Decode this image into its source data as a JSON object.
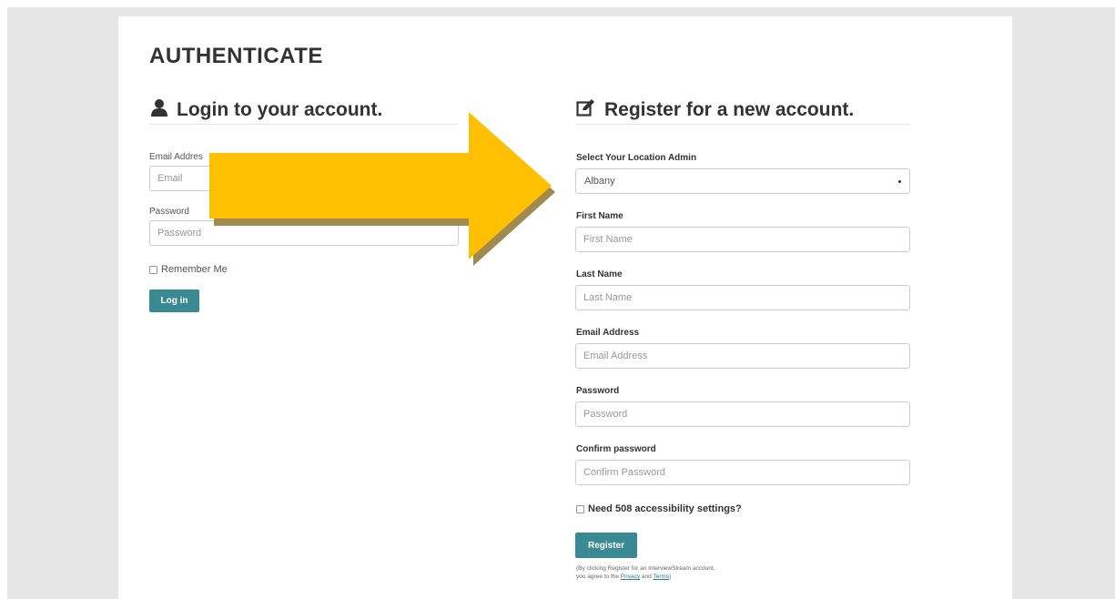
{
  "page": {
    "title": "AUTHENTICATE"
  },
  "login": {
    "heading": "Login to your account.",
    "email_label": "Email Addres",
    "email_placeholder": "Email",
    "password_label": "Password",
    "password_placeholder": "Password",
    "remember_label": "Remember Me",
    "login_button": "Log in"
  },
  "register": {
    "heading": "Register for a new account.",
    "location_label": "Select Your Location Admin",
    "location_value": "Albany",
    "first_name_label": "First Name",
    "first_name_placeholder": "First Name",
    "last_name_label": "Last Name",
    "last_name_placeholder": "Last Name",
    "email_label": "Email Address",
    "email_placeholder": "Email Address",
    "password_label": "Password",
    "password_placeholder": "Password",
    "confirm_label": "Confirm password",
    "confirm_placeholder": "Confirm Password",
    "accessibility_label": "Need 508 accessibility settings?",
    "register_button": "Register",
    "terms_line1": "(By clicking Register for an InterviewStream account,",
    "terms_line2_prefix": "you agree to the ",
    "privacy_link": "Privacy",
    "and": " and ",
    "terms_link": "Terms",
    "terms_suffix": ")"
  },
  "colors": {
    "accent": "#3a8a94",
    "arrow": "#ffc000",
    "arrow_shadow": "#a08a50"
  },
  "icons": {
    "login": "user-icon",
    "register": "edit-icon",
    "arrow": "right-arrow"
  }
}
